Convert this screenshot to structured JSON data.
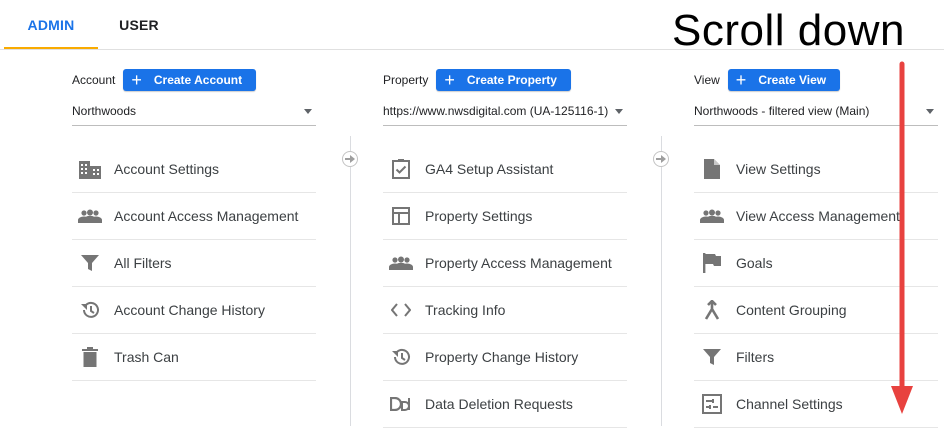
{
  "tabs": [
    {
      "label": "ADMIN",
      "active": true
    },
    {
      "label": "USER",
      "active": false
    }
  ],
  "account": {
    "label": "Account",
    "create_label": "Create Account",
    "selected": "Northwoods",
    "items": [
      {
        "label": "Account Settings",
        "icon": "building-icon"
      },
      {
        "label": "Account Access Management",
        "icon": "people-icon"
      },
      {
        "label": "All Filters",
        "icon": "filter-icon"
      },
      {
        "label": "Account Change History",
        "icon": "history-icon"
      },
      {
        "label": "Trash Can",
        "icon": "trash-icon"
      }
    ]
  },
  "property": {
    "label": "Property",
    "create_label": "Create Property",
    "selected": "https://www.nwsdigital.com (UA-125116-1)",
    "items": [
      {
        "label": "GA4 Setup Assistant",
        "icon": "clipboard-check-icon"
      },
      {
        "label": "Property Settings",
        "icon": "layout-icon"
      },
      {
        "label": "Property Access Management",
        "icon": "people-icon"
      },
      {
        "label": "Tracking Info",
        "icon": "code-icon"
      },
      {
        "label": "Property Change History",
        "icon": "history-icon"
      },
      {
        "label": "Data Deletion Requests",
        "icon": "dd-icon"
      }
    ]
  },
  "view": {
    "label": "View",
    "create_label": "Create View",
    "selected": "Northwoods - filtered view (Main)",
    "items": [
      {
        "label": "View Settings",
        "icon": "document-icon"
      },
      {
        "label": "View Access Management",
        "icon": "people-icon"
      },
      {
        "label": "Goals",
        "icon": "flag-icon"
      },
      {
        "label": "Content Grouping",
        "icon": "grouping-icon"
      },
      {
        "label": "Filters",
        "icon": "filter-icon"
      },
      {
        "label": "Channel Settings",
        "icon": "channel-icon"
      }
    ]
  },
  "annotation": {
    "text": "Scroll down",
    "color": "#e8423f"
  },
  "colors": {
    "accent": "#1a73e8",
    "tab_indicator": "#f9ab00",
    "icon": "#757575"
  }
}
